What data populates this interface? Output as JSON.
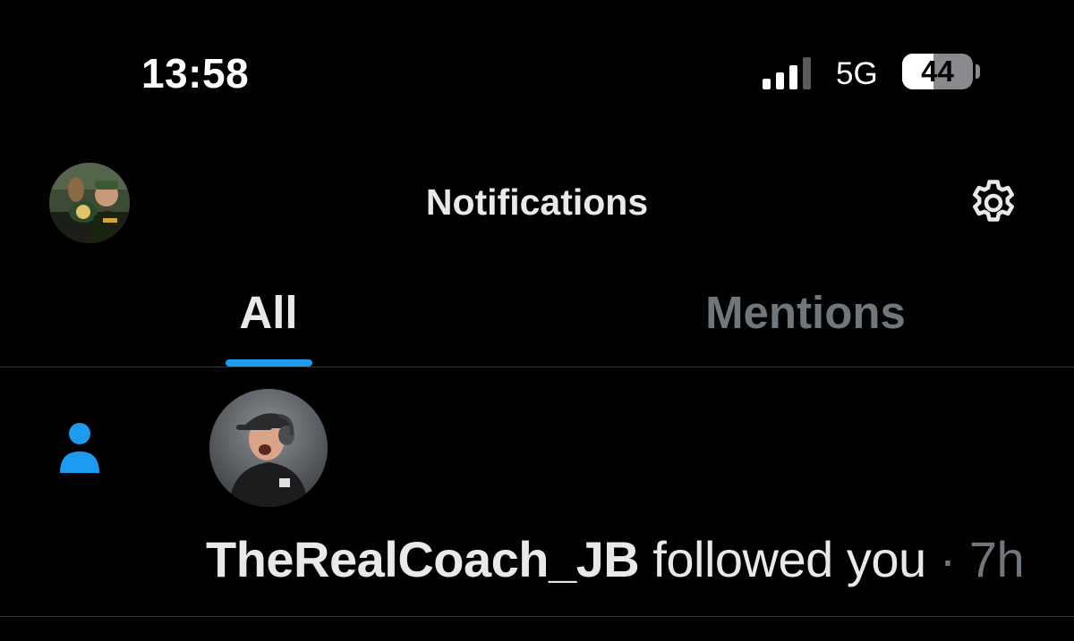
{
  "status_bar": {
    "time": "13:58",
    "signal_bars_active": 3,
    "signal_bars_total": 4,
    "network": "5G",
    "battery_text": "44",
    "battery_level": 0.44
  },
  "header": {
    "title": "Notifications",
    "avatar_icon": "profile-avatar",
    "settings_icon": "gear-icon"
  },
  "tabs": [
    {
      "label": "All",
      "active": true
    },
    {
      "label": "Mentions",
      "active": false
    }
  ],
  "notification": {
    "type_icon": "person-icon",
    "avatar_icon": "user-avatar",
    "username": "TheRealCoach_JB",
    "action": "followed you",
    "separator": "·",
    "time": "7h"
  },
  "colors": {
    "background": "#000000",
    "text_primary": "#e7e9ea",
    "text_secondary": "#71767b",
    "accent": "#1d9bf0",
    "divider": "#2f3336"
  }
}
